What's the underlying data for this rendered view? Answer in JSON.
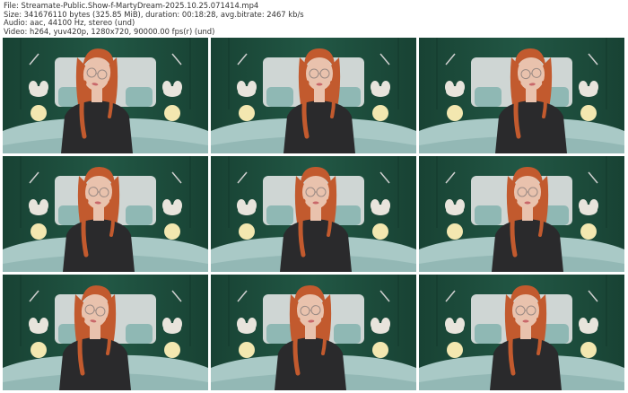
{
  "file_info": {
    "file_line": "File: Streamate-Public.Show-f-MartyDream-2025.10.25.071414.mp4",
    "size_line": "Size: 341676110 bytes (325.85 MiB), duration: 00:18:28, avg.bitrate: 2467 kb/s",
    "audio_line": "Audio: aac, 44100 Hz, stereo (und)",
    "video_line": "Video: h264, yuv420p, 1280x720, 90000.00 fps(r) (und)"
  },
  "thumbnails": [
    {
      "name": "thumbnail-1"
    },
    {
      "name": "thumbnail-2"
    },
    {
      "name": "thumbnail-3"
    },
    {
      "name": "thumbnail-4"
    },
    {
      "name": "thumbnail-5"
    },
    {
      "name": "thumbnail-6"
    },
    {
      "name": "thumbnail-7"
    },
    {
      "name": "thumbnail-8"
    },
    {
      "name": "thumbnail-9"
    }
  ],
  "colors": {
    "wall": "#1d4d3c",
    "bed": "#a9c9c6",
    "headboard": "#cfd6d4",
    "hair": "#c25a2e",
    "sweater": "#2a2a2c",
    "skin": "#e9c2ad",
    "lamp": "#f3e7b0"
  }
}
